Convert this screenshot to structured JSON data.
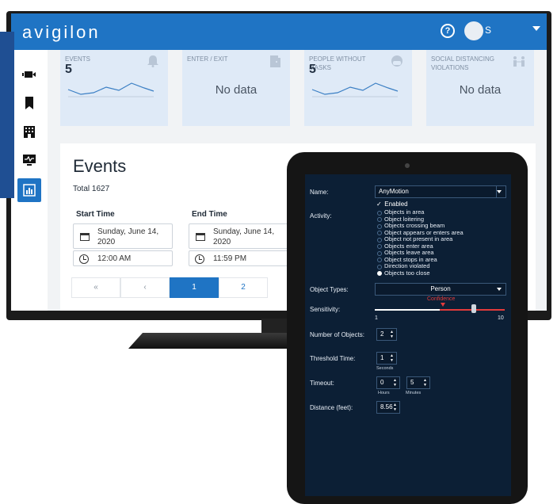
{
  "app": {
    "logo": "avigilon",
    "user_initial": "S"
  },
  "dashboard": {
    "cards": [
      {
        "title": "EVENTS",
        "value": "5",
        "icon": "bell-icon"
      },
      {
        "title": "ENTER / EXIT",
        "value": "No data",
        "icon": "door-icon"
      },
      {
        "title": "PEOPLE WITHOUT MASKS",
        "value": "5",
        "icon": "face-mask-icon"
      },
      {
        "title": "SOCIAL DISTANCING VIOLATIONS",
        "value": "No data",
        "icon": "people-distance-icon"
      }
    ],
    "sidebar_icons": [
      "camera-icon",
      "bookmark-icon",
      "building-icon",
      "monitor-icon",
      "analytics-icon"
    ],
    "accent_color": "#1f74c4"
  },
  "events": {
    "heading": "Events",
    "total": "Total 1627",
    "start_label": "Start Time",
    "end_label": "End Time",
    "start_date": "Sunday, June 14, 2020",
    "start_time": "12:00 AM",
    "end_date": "Sunday, June 14, 2020",
    "end_time": "11:59 PM",
    "pager": {
      "first": "«",
      "prev": "‹",
      "pages": [
        "1",
        "2"
      ],
      "current": "1"
    }
  },
  "tablet": {
    "name_label": "Name:",
    "name_value": "AnyMotion",
    "enabled_label": "Enabled",
    "activity_label": "Activity:",
    "activities": [
      "Objects in area",
      "Object loitering",
      "Objects crossing beam",
      "Object appears or enters area",
      "Object not present in area",
      "Objects enter area",
      "Objects leave area",
      "Object stops in area",
      "Direction violated",
      "Objects too close"
    ],
    "selected_activity": "Objects too close",
    "object_types_label": "Object Types:",
    "object_types_value": "Person",
    "sensitivity_label": "Sensitivity:",
    "confidence_label": "Confidence",
    "sensitivity_min": "1",
    "sensitivity_max": "10",
    "number_of_objects_label": "Number of Objects:",
    "number_of_objects": "2",
    "threshold_time_label": "Threshold Time:",
    "threshold_time": "1",
    "seconds_unit": "Seconds",
    "timeout_label": "Timeout:",
    "timeout_hours": "0",
    "timeout_minutes": "5",
    "hours_unit": "Hours",
    "minutes_unit": "Minutes",
    "distance_label": "Distance (feet):",
    "distance": "8.56"
  }
}
